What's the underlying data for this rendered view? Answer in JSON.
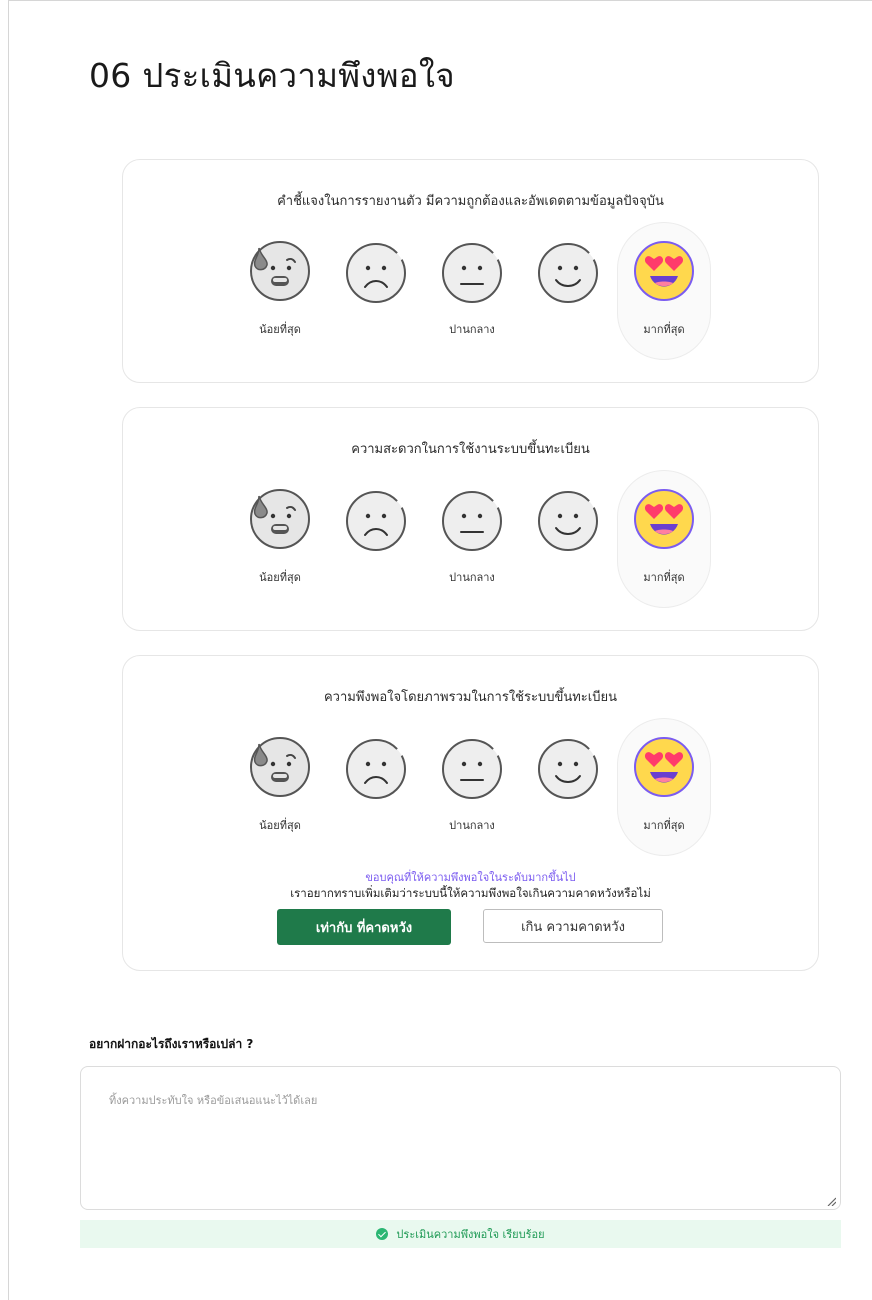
{
  "page": {
    "title": "06 ประเมินความพึงพอใจ"
  },
  "scale": {
    "label_min": "น้อยที่สุด",
    "label_mid": "ปานกลาง",
    "label_max": "มากที่สุด"
  },
  "questions": [
    {
      "text": "คำชี้แจงในการรายงานตัว มีความถูกต้องและอัพเดตตามข้อมูลปัจจุบัน",
      "selected": 5
    },
    {
      "text": "ความสะดวกในการใช้งานระบบขึ้นทะเบียน",
      "selected": 5
    },
    {
      "text": "ความพึงพอใจโดยภาพรวมในการใช้ระบบขึ้นทะเบียน",
      "selected": 5
    }
  ],
  "followup": {
    "thanks": "ขอบคุณที่ให้ความพึงพอใจในระดับมากขึ้นไป",
    "question": "เราอยากทราบเพิ่มเติมว่าระบบนี้ให้ความพึงพอใจเกินความคาดหวังหรือไม่",
    "meets_label": "เท่ากับ ที่คาดหวัง",
    "exceeds_label": "เกิน ความคาดหวัง"
  },
  "feedback": {
    "label": "อยากฝากอะไรถึงเราหรือเปล่า ?",
    "placeholder": "ทิ้งความประทับใจ หรือข้อเสนอแนะไว้ได้เลย",
    "value": ""
  },
  "status": {
    "text": "ประเมินความพึงพอใจ เรียบร้อย"
  },
  "colors": {
    "primary": "#1f7a4a",
    "accent_purple": "#7b5cf0",
    "success": "#2bb673",
    "face_gray": "#e6e6e6",
    "face_selected": "#ffd84d",
    "heart": "#ff3b6b"
  }
}
